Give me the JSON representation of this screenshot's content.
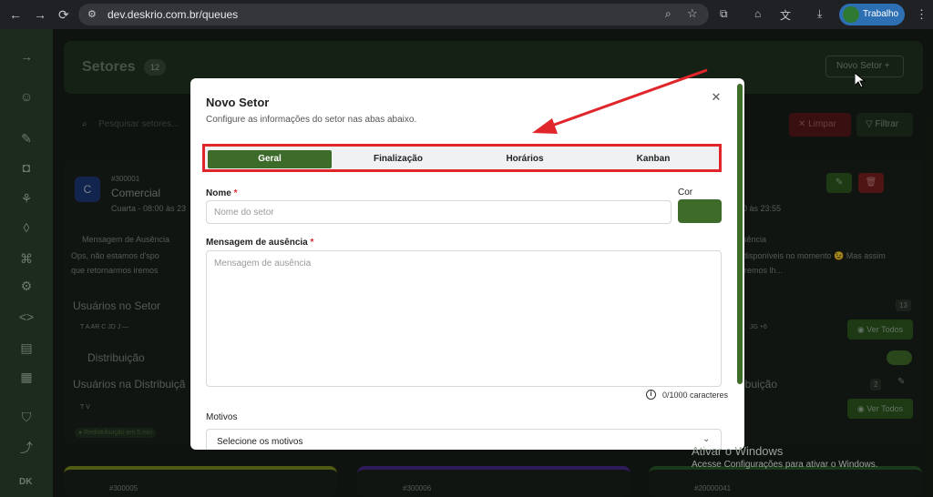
{
  "browser": {
    "url": "dev.deskrio.com.br/queues",
    "profile_label": "Trabalho"
  },
  "page": {
    "heading": "Setores",
    "heading_count": "12",
    "new_button": "Novo Setor",
    "search_placeholder": "Pesquisar setores...",
    "clear_button": "Limpar",
    "filter_button": "Filtrar",
    "card_left": {
      "code": "#300001",
      "name": "Comercial",
      "schedule": "Cuarta - 08:00 às 23",
      "absence_label": "Mensagem de Ausência",
      "absence_text_1": "Ops, não estamos d'spo",
      "absence_text_2": "que retornarmos iremos",
      "users_label": "Usuários no Setor",
      "user_initials": "T  A  AR  C  JD  J  —",
      "distribution_label": "Distribuição",
      "distribution_users_label": "Usuários na Distribuiçã",
      "distribution_initials": "T  V",
      "tag": "● Redistribuição em 5 min"
    },
    "card_right": {
      "schedule": "0 às 23:55",
      "absence_label": "sência",
      "absence_text_1": "disponíveis no momento 😉 Mas assim",
      "absence_text_2": "iremos lh...",
      "count": "13",
      "initials": "JG  +6",
      "see_all": "Ver Todos",
      "distribution_label": "ibuição",
      "dist_count": "2"
    },
    "bottom_cards": [
      "#300005",
      "#300006",
      "#20000041"
    ]
  },
  "modal": {
    "title": "Novo Setor",
    "subtitle": "Configure as informações do setor nas abas abaixo.",
    "tabs": [
      {
        "label": "Geral",
        "active": true
      },
      {
        "label": "Finalização",
        "active": false
      },
      {
        "label": "Horários",
        "active": false
      },
      {
        "label": "Kanban",
        "active": false
      }
    ],
    "name_label": "Nome",
    "required_mark": "*",
    "name_placeholder": "Nome do setor",
    "color_label": "Cor",
    "absence_label": "Mensagem de ausência",
    "absence_placeholder": "Mensagem de ausência",
    "char_counter": "0/1000 caracteres",
    "reasons_label": "Motivos",
    "reasons_select": "Selecione os motivos"
  },
  "watermark": {
    "line1": "Ativar o Windows",
    "line2": "Acesse Configurações para ativar o Windows."
  },
  "sidebar_footer": "DK",
  "colors": {
    "brand_green": "#3d6b2a",
    "annotation_red": "#e0252b"
  }
}
